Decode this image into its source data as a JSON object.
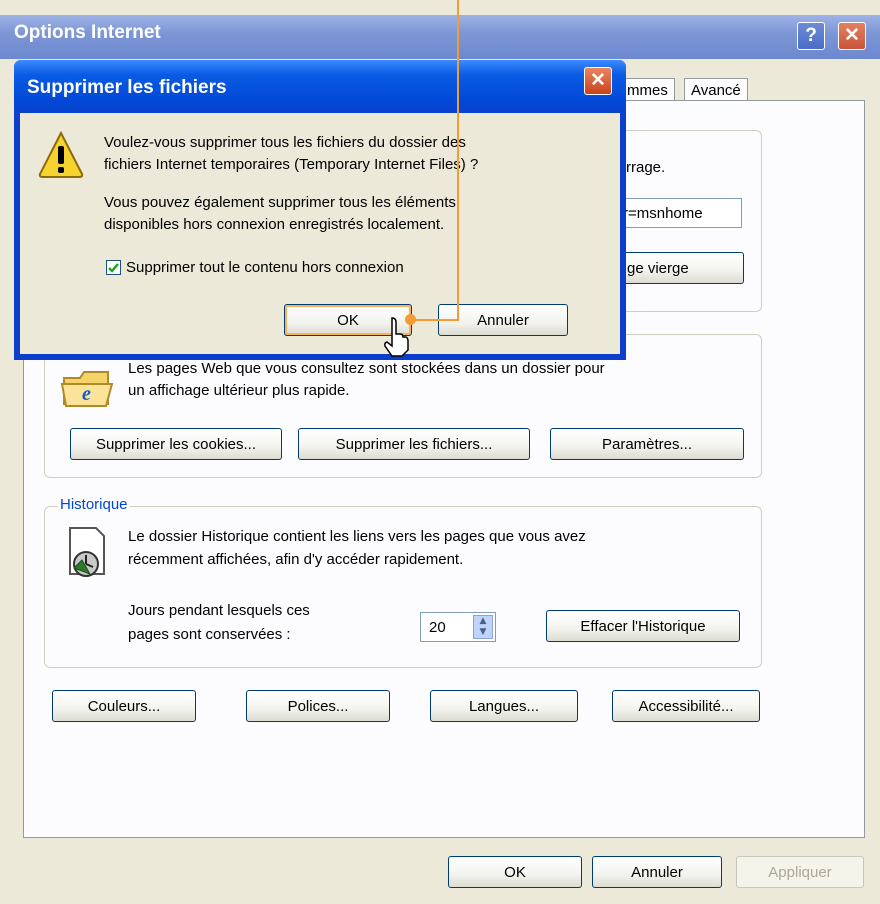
{
  "main_window": {
    "title": "Options Internet",
    "help_glyph": "?",
    "close_glyph": "✕",
    "tabs": [
      {
        "label": "mmes"
      },
      {
        "label": "Avancé"
      }
    ],
    "home_group": {
      "partial_text_1": "rrage.",
      "url_fragment": "r=msnhome",
      "blank_page_btn": "ge vierge"
    },
    "temp_files_group": {
      "line1": "Les pages Web que vous consultez sont stockées dans un dossier pour",
      "line2": "un affichage ultérieur plus rapide.",
      "cookies_btn": "Supprimer les cookies...",
      "delete_files_btn": "Supprimer les fichiers...",
      "settings_btn": "Paramètres..."
    },
    "history_group": {
      "legend": "Historique",
      "line1": "Le dossier Historique contient les liens vers les pages que vous avez",
      "line2": "récemment affichées, afin d'y accéder rapidement.",
      "days_label_1": "Jours pendant lesquels ces",
      "days_label_2": "pages sont conservées :",
      "days_value": "20",
      "clear_btn": "Effacer l'Historique"
    },
    "bottom_buttons": {
      "colors": "Couleurs...",
      "fonts": "Polices...",
      "languages": "Langues...",
      "accessibility": "Accessibilité..."
    },
    "footer": {
      "ok": "OK",
      "cancel": "Annuler",
      "apply": "Appliquer"
    }
  },
  "dialog": {
    "title": "Supprimer les fichiers",
    "close_glyph": "✕",
    "icon": "warning-icon",
    "question_line1": "Voulez-vous supprimer tous les fichiers du dossier des",
    "question_line2": "fichiers Internet temporaires (Temporary Internet Files) ?",
    "info_line1": "Vous pouvez également supprimer tous les éléments",
    "info_line2": "disponibles hors connexion enregistrés localement.",
    "checkbox_label": "Supprimer tout le contenu hors connexion",
    "checkbox_checked": true,
    "ok": "OK",
    "cancel": "Annuler"
  },
  "colors": {
    "accent_orange": "#f39b35",
    "title_blue": "#0248d8",
    "legend_blue": "#0046d5"
  }
}
